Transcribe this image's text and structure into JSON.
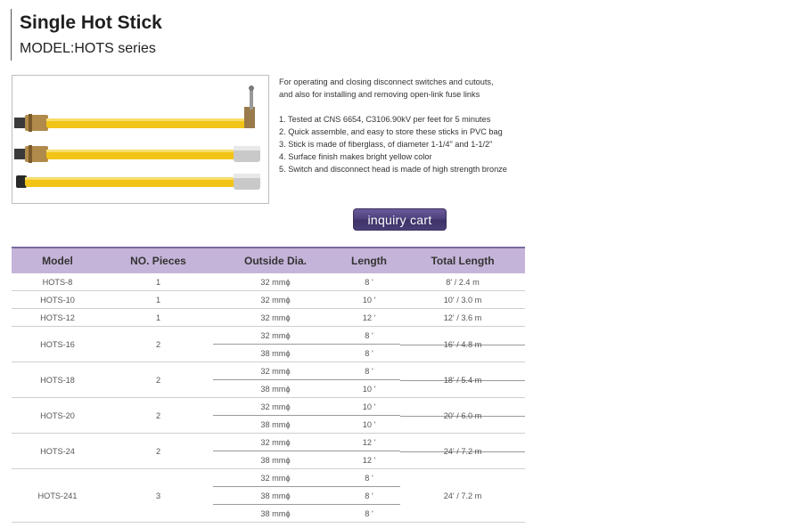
{
  "header": {
    "title": "Single Hot Stick",
    "model_line": "MODEL:HOTS series"
  },
  "description": {
    "intro_1": "For operating and closing disconnect switches and cutouts,",
    "intro_2": "and also for installing and removing open-link fuse links",
    "features": [
      "1. Tested at CNS 6654, C3106.90kV per feet for 5 minutes",
      "2. Quick assemble, and easy to store these sticks in PVC bag",
      "3. Stick is made of fiberglass, of diameter 1-1/4\" and 1-1/2\"",
      "4. Surface finish makes bright yellow color",
      "5. Switch and disconnect head is made of high strength bronze"
    ]
  },
  "inquiry_button": {
    "label": "inquiry cart"
  },
  "colors": {
    "header_bg": "#c5b4d9",
    "accent": "#4c3f7a",
    "stick_yellow": "#f2c417"
  },
  "table": {
    "headers": {
      "model": "Model",
      "pieces": "NO. Pieces",
      "dia": "Outside Dia.",
      "length": "Length",
      "total": "Total Length"
    },
    "rows": [
      {
        "model": "HOTS-8",
        "pieces": "1",
        "parts": [
          {
            "dia": "32 mmϕ",
            "length": "8 '"
          }
        ],
        "total": "8' / 2.4 m"
      },
      {
        "model": "HOTS-10",
        "pieces": "1",
        "parts": [
          {
            "dia": "32 mmϕ",
            "length": "10 '"
          }
        ],
        "total": "10' / 3.0 m"
      },
      {
        "model": "HOTS-12",
        "pieces": "1",
        "parts": [
          {
            "dia": "32 mmϕ",
            "length": "12 '"
          }
        ],
        "total": "12' / 3.6 m"
      },
      {
        "model": "HOTS-16",
        "pieces": "2",
        "parts": [
          {
            "dia": "32 mmϕ",
            "length": "8 '"
          },
          {
            "dia": "38 mmϕ",
            "length": "8 '"
          }
        ],
        "total": "16' / 4.8 m"
      },
      {
        "model": "HOTS-18",
        "pieces": "2",
        "parts": [
          {
            "dia": "32 mmϕ",
            "length": "8 '"
          },
          {
            "dia": "38 mmϕ",
            "length": "10 '"
          }
        ],
        "total": "18' / 5.4 m"
      },
      {
        "model": "HOTS-20",
        "pieces": "2",
        "parts": [
          {
            "dia": "32 mmϕ",
            "length": "10 '"
          },
          {
            "dia": "38 mmϕ",
            "length": "10 '"
          }
        ],
        "total": "20' / 6.0 m"
      },
      {
        "model": "HOTS-24",
        "pieces": "2",
        "parts": [
          {
            "dia": "32 mmϕ",
            "length": "12 '"
          },
          {
            "dia": "38 mmϕ",
            "length": "12 '"
          }
        ],
        "total": "24' / 7.2 m"
      },
      {
        "model": "HOTS-241",
        "pieces": "3",
        "parts": [
          {
            "dia": "32 mmϕ",
            "length": "8 '"
          },
          {
            "dia": "38 mmϕ",
            "length": "8 '"
          },
          {
            "dia": "38 mmϕ",
            "length": "8 '"
          }
        ],
        "total": "24' / 7.2 m"
      }
    ]
  }
}
